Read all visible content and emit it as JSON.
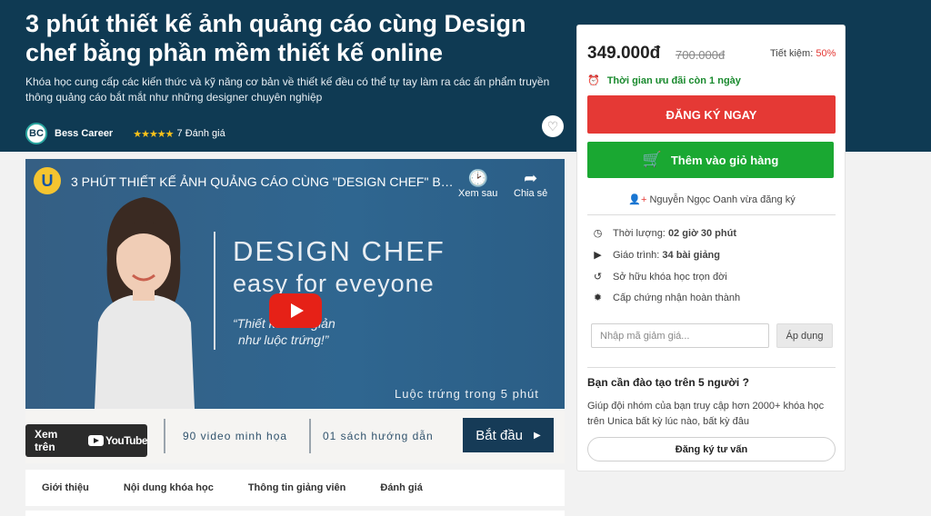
{
  "course": {
    "title": "3 phút thiết kế ảnh quảng cáo cùng Design chef bằng phần mềm thiết kế online",
    "description": "Khóa học cung cấp các kiến thức và kỹ năng cơ bản về thiết kế đều có thể tự tay làm ra các ấn phẩm truyền thông quảng cáo bắt mắt như những designer chuyên nghiệp",
    "author": "Bess Career",
    "author_logo": "BC",
    "stars": "★★★★★",
    "rating": "7 Đánh giá"
  },
  "video": {
    "channel_logo": "U",
    "title": "3 PHÚT THIẾT KẾ ẢNH QUẢNG CÁO CÙNG \"DESIGN CHEF\" BẰNG...",
    "watch_later": "Xem sau",
    "share": "Chia sẻ",
    "heading1": "DESIGN CHEF",
    "heading2": "easy for eveyone",
    "quote_line1": "“Thiết kế đơn giản",
    "quote_line2": "như luộc trứng!”",
    "caption": "Luộc trứng trong 5 phút",
    "watch_on": "Xem trên",
    "youtube": "YouTube",
    "videos_count": "90 video minh họa",
    "books": "01 sách hướng dẫn",
    "start": "Bắt đầu"
  },
  "tabs": [
    "Giới thiệu",
    "Nội dung khóa học",
    "Thông tin giảng viên",
    "Đánh giá"
  ],
  "sidebar": {
    "price": "349.000đ",
    "old_price": "700.000đ",
    "save_label": "Tiết kiệm:",
    "save_pct": "50%",
    "deal": "Thời gian ưu đãi còn 1 ngày",
    "register": "ĐĂNG KÝ NGAY",
    "add_cart": "Thêm vào giỏ hàng",
    "enrolled": "Nguyễn Ngọc Oanh vừa đăng ký",
    "duration_label": "Thời lượng:",
    "duration_value": "02 giờ 30 phút",
    "lessons_label": "Giáo trình:",
    "lessons_value": "34 bài giảng",
    "lifetime": "Sở hữu khóa học trọn đời",
    "certificate": "Cấp chứng nhận hoàn thành",
    "coupon_placeholder": "Nhập mã giảm giá...",
    "apply": "Áp dụng",
    "team_title": "Bạn cần đào tạo trên 5 người ?",
    "team_desc": "Giúp đội nhóm của bạn truy cập hơn 2000+ khóa học trên Unica bất kỳ lúc nào, bất kỳ đâu",
    "consult": "Đăng ký tư vấn"
  },
  "colors": {
    "hero": "#0f3a53",
    "accent_red": "#e53935",
    "accent_green": "#1aa832",
    "star": "#f7c21a"
  }
}
